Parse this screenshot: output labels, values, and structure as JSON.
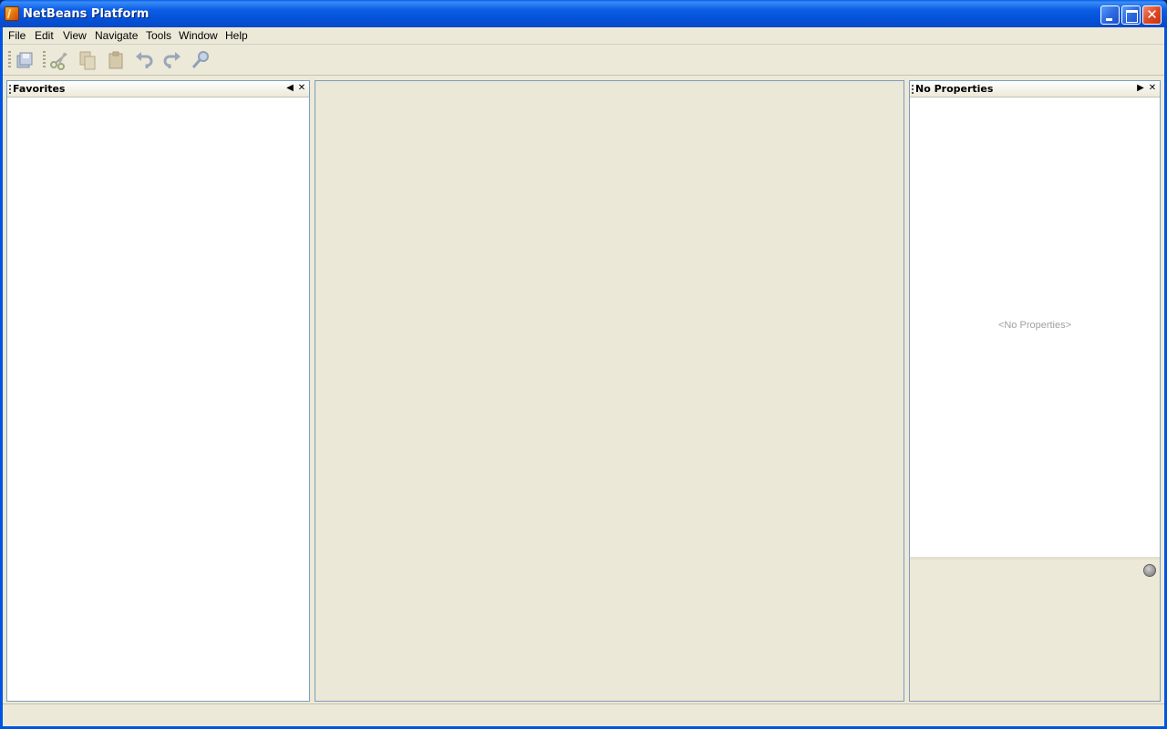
{
  "window": {
    "title": "NetBeans Platform",
    "icon": "netbeans-icon",
    "controls": [
      "minimize-icon",
      "maximize-icon",
      "close-icon"
    ]
  },
  "menubar": {
    "items": [
      "File",
      "Edit",
      "View",
      "Navigate",
      "Tools",
      "Window",
      "Help"
    ]
  },
  "toolbar": {
    "buttons": [
      {
        "name": "save-all",
        "icon": "save-all-icon"
      },
      {
        "name": "cut",
        "icon": "cut-icon"
      },
      {
        "name": "copy",
        "icon": "copy-icon"
      },
      {
        "name": "paste",
        "icon": "paste-icon"
      },
      {
        "name": "undo",
        "icon": "undo-icon"
      },
      {
        "name": "redo",
        "icon": "redo-icon"
      },
      {
        "name": "find",
        "icon": "find-icon"
      }
    ]
  },
  "favorites_panel": {
    "title": "Favorites",
    "icons": [
      "minimize-panel-icon",
      "close-icon"
    ]
  },
  "properties_panel": {
    "title": "No Properties",
    "placeholder": "<No Properties>",
    "icons": [
      "minimize-panel-icon",
      "close-icon",
      "help-icon"
    ]
  },
  "colors": {
    "titlebar": "#0054e3",
    "chrome": "#ece9d8",
    "panel_border": "#7f9db9"
  }
}
